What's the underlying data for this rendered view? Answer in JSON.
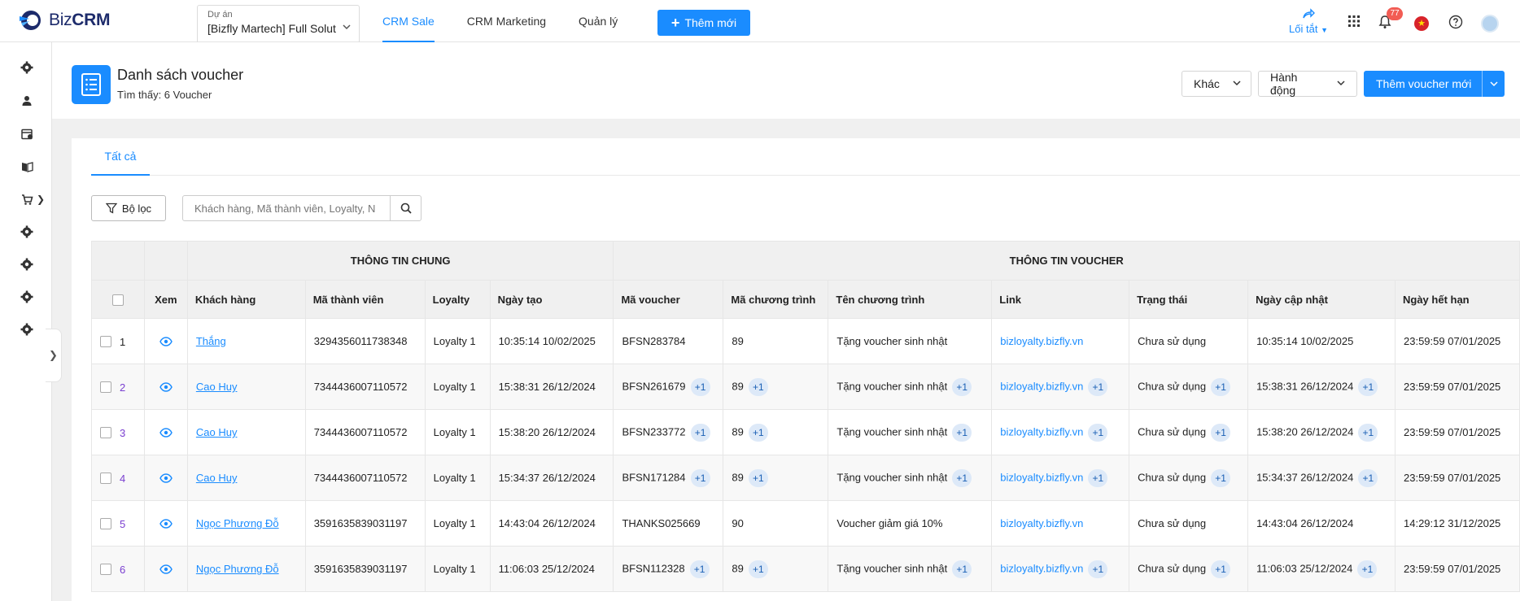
{
  "app": {
    "logo_biz": "Biz",
    "logo_crm": "CRM"
  },
  "project": {
    "label": "Dự án",
    "value": "[Bizfly Martech] Full Solut"
  },
  "nav": [
    {
      "label": "CRM Sale",
      "active": true
    },
    {
      "label": "CRM Marketing",
      "active": false
    },
    {
      "label": "Quản lý",
      "active": false
    }
  ],
  "add_new_label": "Thêm mới",
  "shortcut_label": "Lối tắt",
  "notifications_count": "77",
  "sidebar_icons": [
    "gear-icon",
    "user-icon",
    "calendar-icon",
    "book-icon",
    "cart-icon",
    "gear-icon",
    "gear-icon",
    "gear-icon",
    "gear-icon"
  ],
  "page": {
    "title": "Danh sách voucher",
    "subtitle": "Tìm thấy: 6 Voucher",
    "btn_other": "Khác",
    "btn_action": "Hành động",
    "btn_add_voucher": "Thêm voucher mới"
  },
  "tabs": [
    {
      "label": "Tất cả"
    }
  ],
  "filter_label": "Bộ lọc",
  "search": {
    "placeholder": "Khách hàng, Mã thành viên, Loyalty, N",
    "value": ""
  },
  "table": {
    "group_headers": [
      "THÔNG TIN CHUNG",
      "THÔNG TIN VOUCHER"
    ],
    "columns": [
      "",
      "Xem",
      "Khách hàng",
      "Mã thành viên",
      "Loyalty",
      "Ngày tạo",
      "Mã voucher",
      "Mã chương trình",
      "Tên chương trình",
      "Link",
      "Trạng thái",
      "Ngày cập nhật",
      "Ngày hết hạn"
    ],
    "rows": [
      {
        "no": "1",
        "customer": "Thắng",
        "member": "3294356011738348",
        "loyalty": "Loyalty 1",
        "created": "10:35:14 10/02/2025",
        "voucher": "BFSN283784",
        "program_code": "89",
        "program_name": "Tặng voucher sinh nhật",
        "link": "bizloyalty.bizfly.vn",
        "status": "Chưa sử dụng",
        "updated": "10:35:14 10/02/2025",
        "expires": "23:59:59 07/01/2025",
        "extra": ""
      },
      {
        "no": "2",
        "customer": "Cao Huy",
        "member": "7344436007110572",
        "loyalty": "Loyalty 1",
        "created": "15:38:31 26/12/2024",
        "voucher": "BFSN261679",
        "program_code": "89",
        "program_name": "Tặng voucher sinh nhật",
        "link": "bizloyalty.bizfly.vn",
        "status": "Chưa sử dụng",
        "updated": "15:38:31 26/12/2024",
        "expires": "23:59:59 07/01/2025",
        "extra": "+1"
      },
      {
        "no": "3",
        "customer": "Cao Huy",
        "member": "7344436007110572",
        "loyalty": "Loyalty 1",
        "created": "15:38:20 26/12/2024",
        "voucher": "BFSN233772",
        "program_code": "89",
        "program_name": "Tặng voucher sinh nhật",
        "link": "bizloyalty.bizfly.vn",
        "status": "Chưa sử dụng",
        "updated": "15:38:20 26/12/2024",
        "expires": "23:59:59 07/01/2025",
        "extra": "+1"
      },
      {
        "no": "4",
        "customer": "Cao Huy",
        "member": "7344436007110572",
        "loyalty": "Loyalty 1",
        "created": "15:34:37 26/12/2024",
        "voucher": "BFSN171284",
        "program_code": "89",
        "program_name": "Tặng voucher sinh nhật",
        "link": "bizloyalty.bizfly.vn",
        "status": "Chưa sử dụng",
        "updated": "15:34:37 26/12/2024",
        "expires": "23:59:59 07/01/2025",
        "extra": "+1"
      },
      {
        "no": "5",
        "customer": "Ngọc Phương Đỗ",
        "member": "3591635839031197",
        "loyalty": "Loyalty 1",
        "created": "14:43:04 26/12/2024",
        "voucher": "THANKS025669",
        "program_code": "90",
        "program_name": "Voucher giảm giá 10%",
        "link": "bizloyalty.bizfly.vn",
        "status": "Chưa sử dụng",
        "updated": "14:43:04 26/12/2024",
        "expires": "14:29:12 31/12/2025",
        "extra": ""
      },
      {
        "no": "6",
        "customer": "Ngọc Phương Đỗ",
        "member": "3591635839031197",
        "loyalty": "Loyalty 1",
        "created": "11:06:03 25/12/2024",
        "voucher": "BFSN112328",
        "program_code": "89",
        "program_name": "Tặng voucher sinh nhật",
        "link": "bizloyalty.bizfly.vn",
        "status": "Chưa sử dụng",
        "updated": "11:06:03 25/12/2024",
        "expires": "23:59:59 07/01/2025",
        "extra": "+1"
      }
    ]
  },
  "colors": {
    "primary": "#1a8cff",
    "brand_dark": "#1d2b6b",
    "badge": "#f25c54",
    "row_number_purple": "#7a3fd0"
  }
}
